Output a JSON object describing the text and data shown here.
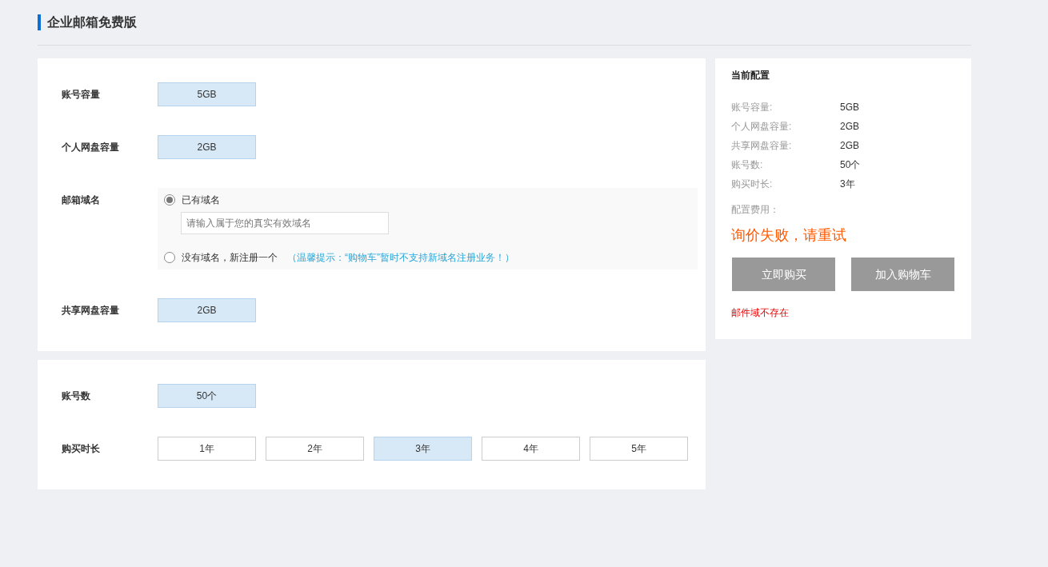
{
  "title": "企业邮箱免费版",
  "section1": [
    {
      "kind": "options",
      "label": "账号容量",
      "options": [
        {
          "label": "5GB",
          "selected": true
        }
      ]
    },
    {
      "kind": "options",
      "label": "个人网盘容量",
      "options": [
        {
          "label": "2GB",
          "selected": true
        }
      ]
    },
    {
      "kind": "domain",
      "label": "邮箱域名",
      "radios": [
        {
          "label": "已有域名",
          "selected": true,
          "placeholder": "请输入属于您的真实有效域名"
        },
        {
          "label": "没有域名，新注册一个",
          "selected": false,
          "hint": "（温馨提示：“购物车”暂时不支持新域名注册业务！）"
        }
      ]
    },
    {
      "kind": "options",
      "label": "共享网盘容量",
      "options": [
        {
          "label": "2GB",
          "selected": true
        }
      ]
    }
  ],
  "section2": [
    {
      "kind": "options",
      "label": "账号数",
      "options": [
        {
          "label": "50个",
          "selected": true
        }
      ]
    },
    {
      "kind": "options",
      "label": "购买时长",
      "options": [
        {
          "label": "1年",
          "selected": false
        },
        {
          "label": "2年",
          "selected": false
        },
        {
          "label": "3年",
          "selected": true
        },
        {
          "label": "4年",
          "selected": false
        },
        {
          "label": "5年",
          "selected": false
        }
      ]
    }
  ],
  "summary": {
    "title": "当前配置",
    "items": [
      {
        "label": "账号容量:",
        "value": "5GB"
      },
      {
        "label": "个人网盘容量:",
        "value": "2GB"
      },
      {
        "label": "共享网盘容量:",
        "value": "2GB"
      },
      {
        "label": "账号数:",
        "value": "50个"
      },
      {
        "label": "购买时长:",
        "value": "3年"
      }
    ],
    "fee_label": "配置费用：",
    "price_error": "询价失败，请重试",
    "buttons": [
      "立即购买",
      "加入购物车"
    ],
    "error": "邮件域不存在"
  }
}
